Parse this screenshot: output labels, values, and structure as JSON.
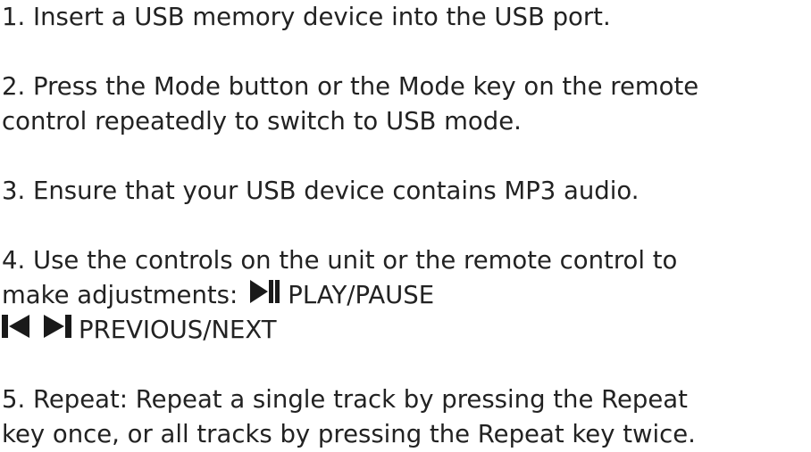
{
  "steps": {
    "step1": "1. Insert a USB memory device into the USB port.",
    "step2_line1": "2. Press the Mode button or the Mode key on the remote",
    "step2_line2": "control repeatedly to switch to USB mode.",
    "step3": "3. Ensure that your USB device contains MP3 audio.",
    "step4_line1": "4. Use the controls on the unit or the remote control to",
    "step4_line2": "make adjustments:",
    "play_pause_label": "PLAY/PAUSE",
    "prev_next_label": "PREVIOUS/NEXT",
    "step5_line1": "5. Repeat: Repeat a single track by pressing the Repeat",
    "step5_line2": "key once, or all tracks by pressing the Repeat key twice."
  },
  "icons": {
    "play_pause": "play-pause-icon",
    "previous": "previous-track-icon",
    "next": "next-track-icon"
  },
  "colors": {
    "text": "#222222",
    "icon": "#1a1a1a"
  }
}
